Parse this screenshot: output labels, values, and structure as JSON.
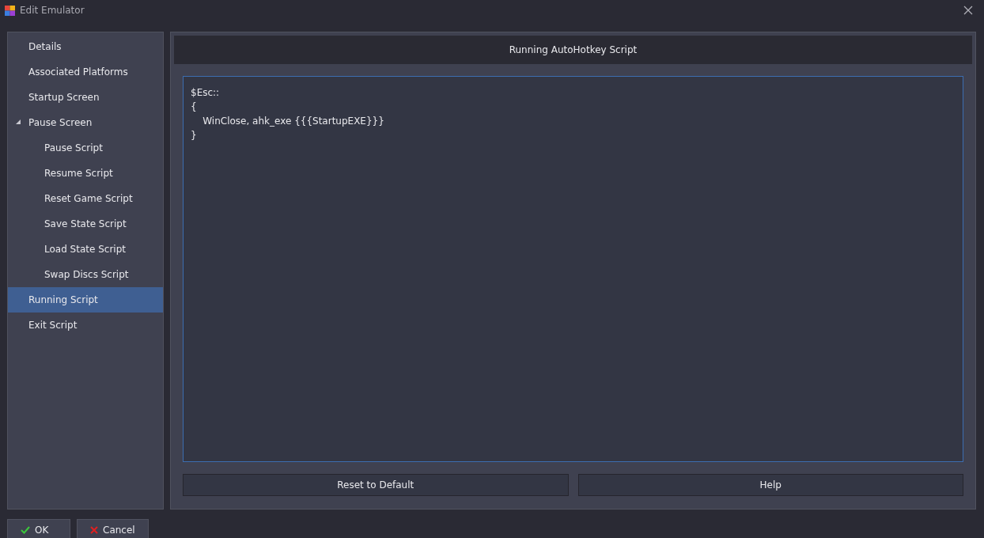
{
  "window": {
    "title": "Edit Emulator"
  },
  "sidebar": {
    "items": [
      {
        "label": "Details",
        "selected": false
      },
      {
        "label": "Associated Platforms",
        "selected": false
      },
      {
        "label": "Startup Screen",
        "selected": false
      },
      {
        "label": "Pause Screen",
        "selected": false,
        "expanded": true,
        "children": [
          {
            "label": "Pause Script",
            "selected": false
          },
          {
            "label": "Resume Script",
            "selected": false
          },
          {
            "label": "Reset Game Script",
            "selected": false
          },
          {
            "label": "Save State Script",
            "selected": false
          },
          {
            "label": "Load State Script",
            "selected": false
          },
          {
            "label": "Swap Discs Script",
            "selected": false
          }
        ]
      },
      {
        "label": "Running Script",
        "selected": true
      },
      {
        "label": "Exit Script",
        "selected": false
      }
    ]
  },
  "panel": {
    "header": "Running AutoHotkey Script",
    "code_lines": [
      "$Esc::",
      "{",
      "    WinClose, ahk_exe {{{StartupEXE}}}",
      "}"
    ],
    "buttons": [
      "Reset to Default",
      "Help"
    ]
  },
  "footer": {
    "buttons": [
      {
        "kind": "ok",
        "label": "OK"
      },
      {
        "kind": "cancel",
        "label": "Cancel"
      }
    ]
  }
}
